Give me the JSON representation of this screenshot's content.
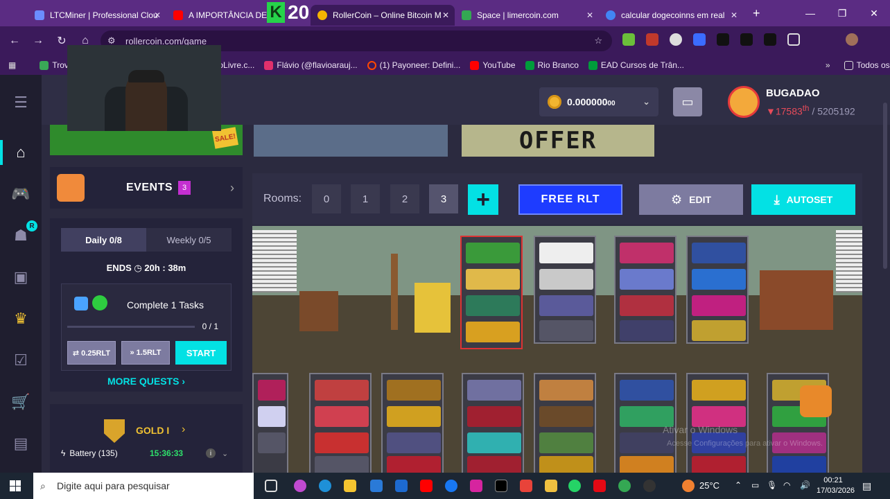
{
  "browser": {
    "tabs": [
      {
        "title": "LTCMiner | Professional Clou",
        "favicon_color": "#6b8cff"
      },
      {
        "title": "A IMPORTÂNCIA DE C",
        "favicon_color": "#ff0000"
      },
      {
        "title": "RollerCoin – Online Bitcoin M",
        "favicon_color": "#f4b400"
      },
      {
        "title": "Space | limercoin.com",
        "favicon_color": "#34a853"
      },
      {
        "title": "calcular dogecoinns em real",
        "favicon_color": "#4285f4"
      }
    ],
    "new_tab": "+",
    "url": "rollercoin.com/game",
    "bookmarks": [
      {
        "label": "Trov",
        "color": "#3aa757"
      },
      {
        "label": "| MercadoLivre.c...",
        "color": "#ffe600"
      },
      {
        "label": "Flávio (@flavioarauj...",
        "color": "#e1306c"
      },
      {
        "label": "(1) Payoneer: Defini...",
        "color": "#ff4800"
      },
      {
        "label": "YouTube",
        "color": "#ff0000"
      },
      {
        "label": "Rio Branco",
        "color": "#009c3b"
      },
      {
        "label": "EAD Cursos de Trân...",
        "color": "#009c3b"
      }
    ],
    "all_favorites": "Todos os favoritos"
  },
  "overlay": {
    "number": "20",
    "k": "K"
  },
  "header": {
    "balance": "0.000000",
    "balance_small": "00",
    "username": "BUGADAO",
    "rank": "17583",
    "rank_suffix": "th",
    "total": "/ 5205192"
  },
  "events": {
    "title": "EVENTS",
    "count": "3"
  },
  "quests": {
    "tab_daily": "Daily  0/8",
    "tab_weekly": "Weekly  0/5",
    "ends_label": "ENDS",
    "ends_time": "20h : 38m",
    "task_name": "Complete 1 Tasks",
    "task_progress": "0 / 1",
    "task_progress_fraction": 0,
    "reward1": "⇄ 0.25RLT",
    "reward2": "» 1.5RLT",
    "start": "START",
    "more": "MORE QUESTS"
  },
  "league": {
    "name": "GOLD I",
    "battery_label": "Battery (135)",
    "battery_time": "15:36:33"
  },
  "game": {
    "rooms_label": "Rooms:",
    "rooms": [
      "0",
      "1",
      "2",
      "3"
    ],
    "active_room": "3",
    "free_rlt": "FREE RLT",
    "edit": "EDIT",
    "autoset": "AUTOSET",
    "offer_text": "OFFER"
  },
  "watermark": {
    "line1": "Ativar o Windows",
    "line2": "Acesse Configurações para ativar o Windows."
  },
  "taskbar": {
    "search_placeholder": "Digite aqui para pesquisar",
    "temperature": "25°C",
    "time": "00:21",
    "date": "17/03/2026"
  }
}
